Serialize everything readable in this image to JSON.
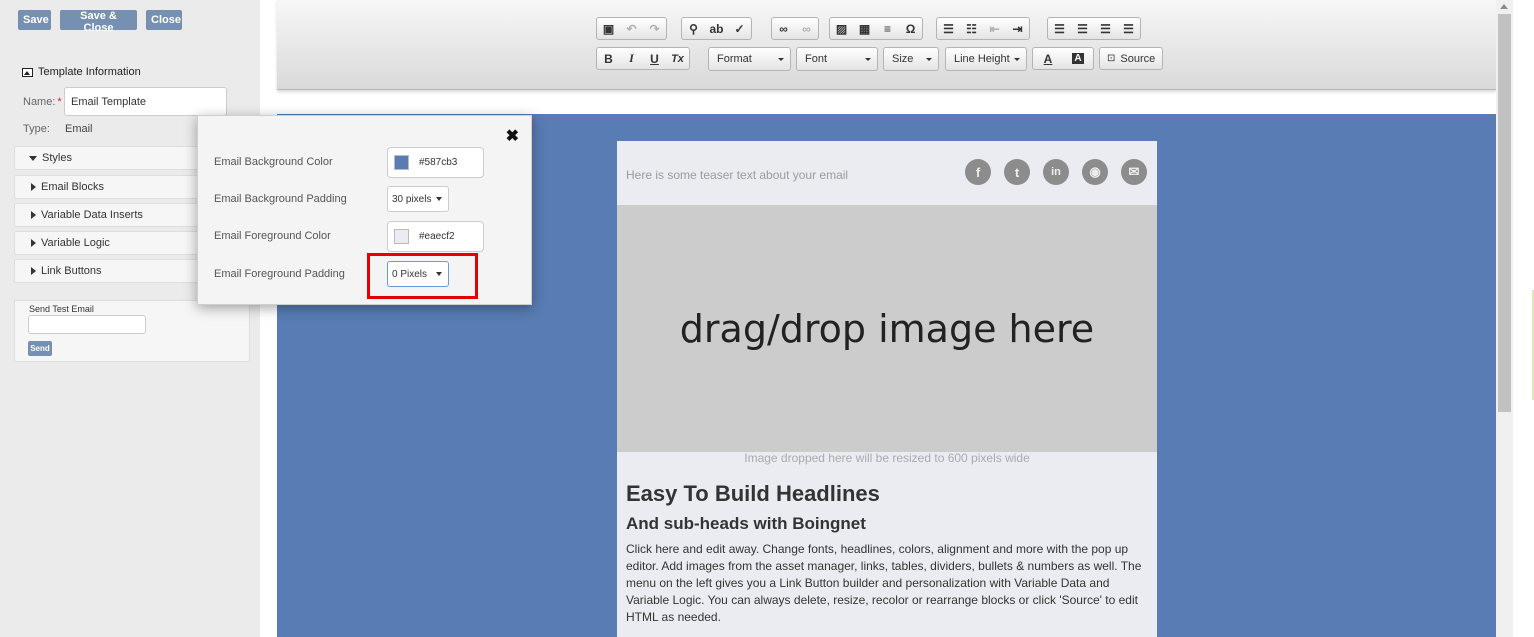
{
  "sidebar": {
    "buttons": {
      "save": "Save",
      "save_close": "Save & Close",
      "close": "Close"
    },
    "template_info": {
      "title": "Template Information",
      "name_label": "Name:",
      "required_mark": "*",
      "name_value": "Email Template",
      "type_label": "Type:",
      "type_value": "Email"
    },
    "accordion": [
      "Styles",
      "Email Blocks",
      "Variable Data Inserts",
      "Variable Logic",
      "Link Buttons"
    ],
    "test_email": {
      "label": "Send Test Email",
      "value": "",
      "send": "Send"
    }
  },
  "toolbar": {
    "format": "Format",
    "font": "Font",
    "size": "Size",
    "line_height": "Line Height",
    "text_color": "A",
    "bg_color": "A",
    "source": "Source",
    "icons": [
      "paste-from-word-icon",
      "undo-icon",
      "redo-icon",
      "find-icon",
      "replace-icon",
      "spellcheck-icon",
      "link-icon",
      "unlink-icon",
      "image-icon",
      "table-icon",
      "horizontal-line-icon",
      "special-char-icon",
      "numbered-list-icon",
      "bullet-list-icon",
      "outdent-icon",
      "indent-icon",
      "align-left-icon",
      "align-center-icon",
      "align-right-icon",
      "justify-icon",
      "bold-icon",
      "italic-icon",
      "underline-icon",
      "remove-format-icon"
    ],
    "glyphs": {
      "bold": "B",
      "italic": "I",
      "underline": "U",
      "remove_format": "Tx",
      "omega": "Ω"
    }
  },
  "popup": {
    "close": "✖",
    "rows": [
      {
        "label": "Email Background Color",
        "value": "#587cb3",
        "swatch": "#587cb3"
      },
      {
        "label": "Email Background Padding",
        "value": "30 pixels"
      },
      {
        "label": "Email Foreground Color",
        "value": "#eaecf2",
        "swatch": "#eaecf2"
      },
      {
        "label": "Email Foreground Padding",
        "value": "0 Pixels"
      }
    ]
  },
  "email": {
    "teaser": "Here is some teaser text about your email",
    "social": [
      {
        "name": "facebook-icon",
        "glyph": "f"
      },
      {
        "name": "tumblr-icon",
        "glyph": "t"
      },
      {
        "name": "linkedin-icon",
        "glyph": "in"
      },
      {
        "name": "rss-icon",
        "glyph": "◉"
      },
      {
        "name": "email-icon",
        "glyph": "✉"
      }
    ],
    "image_placeholder": "drag/drop image here",
    "image_caption": "Image dropped here will be resized to 600 pixels wide",
    "headline": "Easy To Build Headlines",
    "subhead": "And sub-heads with Boingnet",
    "body": "Click here and edit away. Change fonts, headlines, colors, alignment and more with the pop up editor. Add images from the asset manager, links, tables, dividers, bullets & numbers as well. The menu on the left gives you a Link Button builder and personalization with Variable Data and Variable Logic. You can always delete, resize, recolor or rearrange blocks or click 'Source' to edit HTML as needed."
  },
  "colors": {
    "accent_button": "#7590b0",
    "canvas_bg": "#587cb3",
    "card_bg": "#eaecf2",
    "highlight": "#e60000"
  }
}
